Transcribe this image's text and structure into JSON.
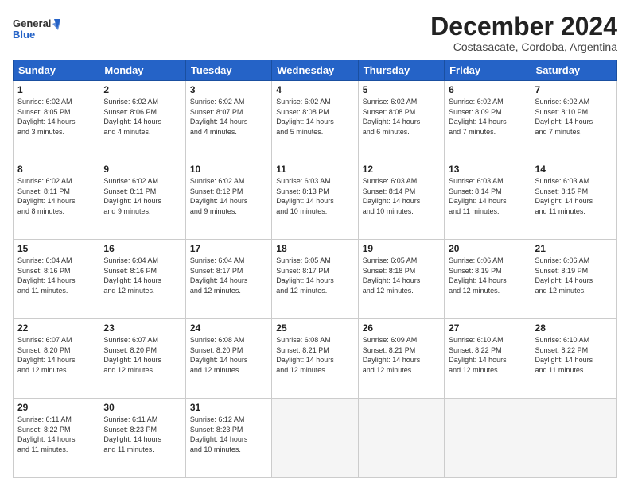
{
  "logo": {
    "general": "General",
    "blue": "Blue"
  },
  "header": {
    "month": "December 2024",
    "location": "Costasacate, Cordoba, Argentina"
  },
  "days_of_week": [
    "Sunday",
    "Monday",
    "Tuesday",
    "Wednesday",
    "Thursday",
    "Friday",
    "Saturday"
  ],
  "weeks": [
    [
      {
        "day": "1",
        "info": "Sunrise: 6:02 AM\nSunset: 8:05 PM\nDaylight: 14 hours\nand 3 minutes."
      },
      {
        "day": "2",
        "info": "Sunrise: 6:02 AM\nSunset: 8:06 PM\nDaylight: 14 hours\nand 4 minutes."
      },
      {
        "day": "3",
        "info": "Sunrise: 6:02 AM\nSunset: 8:07 PM\nDaylight: 14 hours\nand 4 minutes."
      },
      {
        "day": "4",
        "info": "Sunrise: 6:02 AM\nSunset: 8:08 PM\nDaylight: 14 hours\nand 5 minutes."
      },
      {
        "day": "5",
        "info": "Sunrise: 6:02 AM\nSunset: 8:08 PM\nDaylight: 14 hours\nand 6 minutes."
      },
      {
        "day": "6",
        "info": "Sunrise: 6:02 AM\nSunset: 8:09 PM\nDaylight: 14 hours\nand 7 minutes."
      },
      {
        "day": "7",
        "info": "Sunrise: 6:02 AM\nSunset: 8:10 PM\nDaylight: 14 hours\nand 7 minutes."
      }
    ],
    [
      {
        "day": "8",
        "info": "Sunrise: 6:02 AM\nSunset: 8:11 PM\nDaylight: 14 hours\nand 8 minutes."
      },
      {
        "day": "9",
        "info": "Sunrise: 6:02 AM\nSunset: 8:11 PM\nDaylight: 14 hours\nand 9 minutes."
      },
      {
        "day": "10",
        "info": "Sunrise: 6:02 AM\nSunset: 8:12 PM\nDaylight: 14 hours\nand 9 minutes."
      },
      {
        "day": "11",
        "info": "Sunrise: 6:03 AM\nSunset: 8:13 PM\nDaylight: 14 hours\nand 10 minutes."
      },
      {
        "day": "12",
        "info": "Sunrise: 6:03 AM\nSunset: 8:14 PM\nDaylight: 14 hours\nand 10 minutes."
      },
      {
        "day": "13",
        "info": "Sunrise: 6:03 AM\nSunset: 8:14 PM\nDaylight: 14 hours\nand 11 minutes."
      },
      {
        "day": "14",
        "info": "Sunrise: 6:03 AM\nSunset: 8:15 PM\nDaylight: 14 hours\nand 11 minutes."
      }
    ],
    [
      {
        "day": "15",
        "info": "Sunrise: 6:04 AM\nSunset: 8:16 PM\nDaylight: 14 hours\nand 11 minutes."
      },
      {
        "day": "16",
        "info": "Sunrise: 6:04 AM\nSunset: 8:16 PM\nDaylight: 14 hours\nand 12 minutes."
      },
      {
        "day": "17",
        "info": "Sunrise: 6:04 AM\nSunset: 8:17 PM\nDaylight: 14 hours\nand 12 minutes."
      },
      {
        "day": "18",
        "info": "Sunrise: 6:05 AM\nSunset: 8:17 PM\nDaylight: 14 hours\nand 12 minutes."
      },
      {
        "day": "19",
        "info": "Sunrise: 6:05 AM\nSunset: 8:18 PM\nDaylight: 14 hours\nand 12 minutes."
      },
      {
        "day": "20",
        "info": "Sunrise: 6:06 AM\nSunset: 8:19 PM\nDaylight: 14 hours\nand 12 minutes."
      },
      {
        "day": "21",
        "info": "Sunrise: 6:06 AM\nSunset: 8:19 PM\nDaylight: 14 hours\nand 12 minutes."
      }
    ],
    [
      {
        "day": "22",
        "info": "Sunrise: 6:07 AM\nSunset: 8:20 PM\nDaylight: 14 hours\nand 12 minutes."
      },
      {
        "day": "23",
        "info": "Sunrise: 6:07 AM\nSunset: 8:20 PM\nDaylight: 14 hours\nand 12 minutes."
      },
      {
        "day": "24",
        "info": "Sunrise: 6:08 AM\nSunset: 8:20 PM\nDaylight: 14 hours\nand 12 minutes."
      },
      {
        "day": "25",
        "info": "Sunrise: 6:08 AM\nSunset: 8:21 PM\nDaylight: 14 hours\nand 12 minutes."
      },
      {
        "day": "26",
        "info": "Sunrise: 6:09 AM\nSunset: 8:21 PM\nDaylight: 14 hours\nand 12 minutes."
      },
      {
        "day": "27",
        "info": "Sunrise: 6:10 AM\nSunset: 8:22 PM\nDaylight: 14 hours\nand 12 minutes."
      },
      {
        "day": "28",
        "info": "Sunrise: 6:10 AM\nSunset: 8:22 PM\nDaylight: 14 hours\nand 11 minutes."
      }
    ],
    [
      {
        "day": "29",
        "info": "Sunrise: 6:11 AM\nSunset: 8:22 PM\nDaylight: 14 hours\nand 11 minutes."
      },
      {
        "day": "30",
        "info": "Sunrise: 6:11 AM\nSunset: 8:23 PM\nDaylight: 14 hours\nand 11 minutes."
      },
      {
        "day": "31",
        "info": "Sunrise: 6:12 AM\nSunset: 8:23 PM\nDaylight: 14 hours\nand 10 minutes."
      },
      {
        "day": "",
        "info": ""
      },
      {
        "day": "",
        "info": ""
      },
      {
        "day": "",
        "info": ""
      },
      {
        "day": "",
        "info": ""
      }
    ]
  ]
}
